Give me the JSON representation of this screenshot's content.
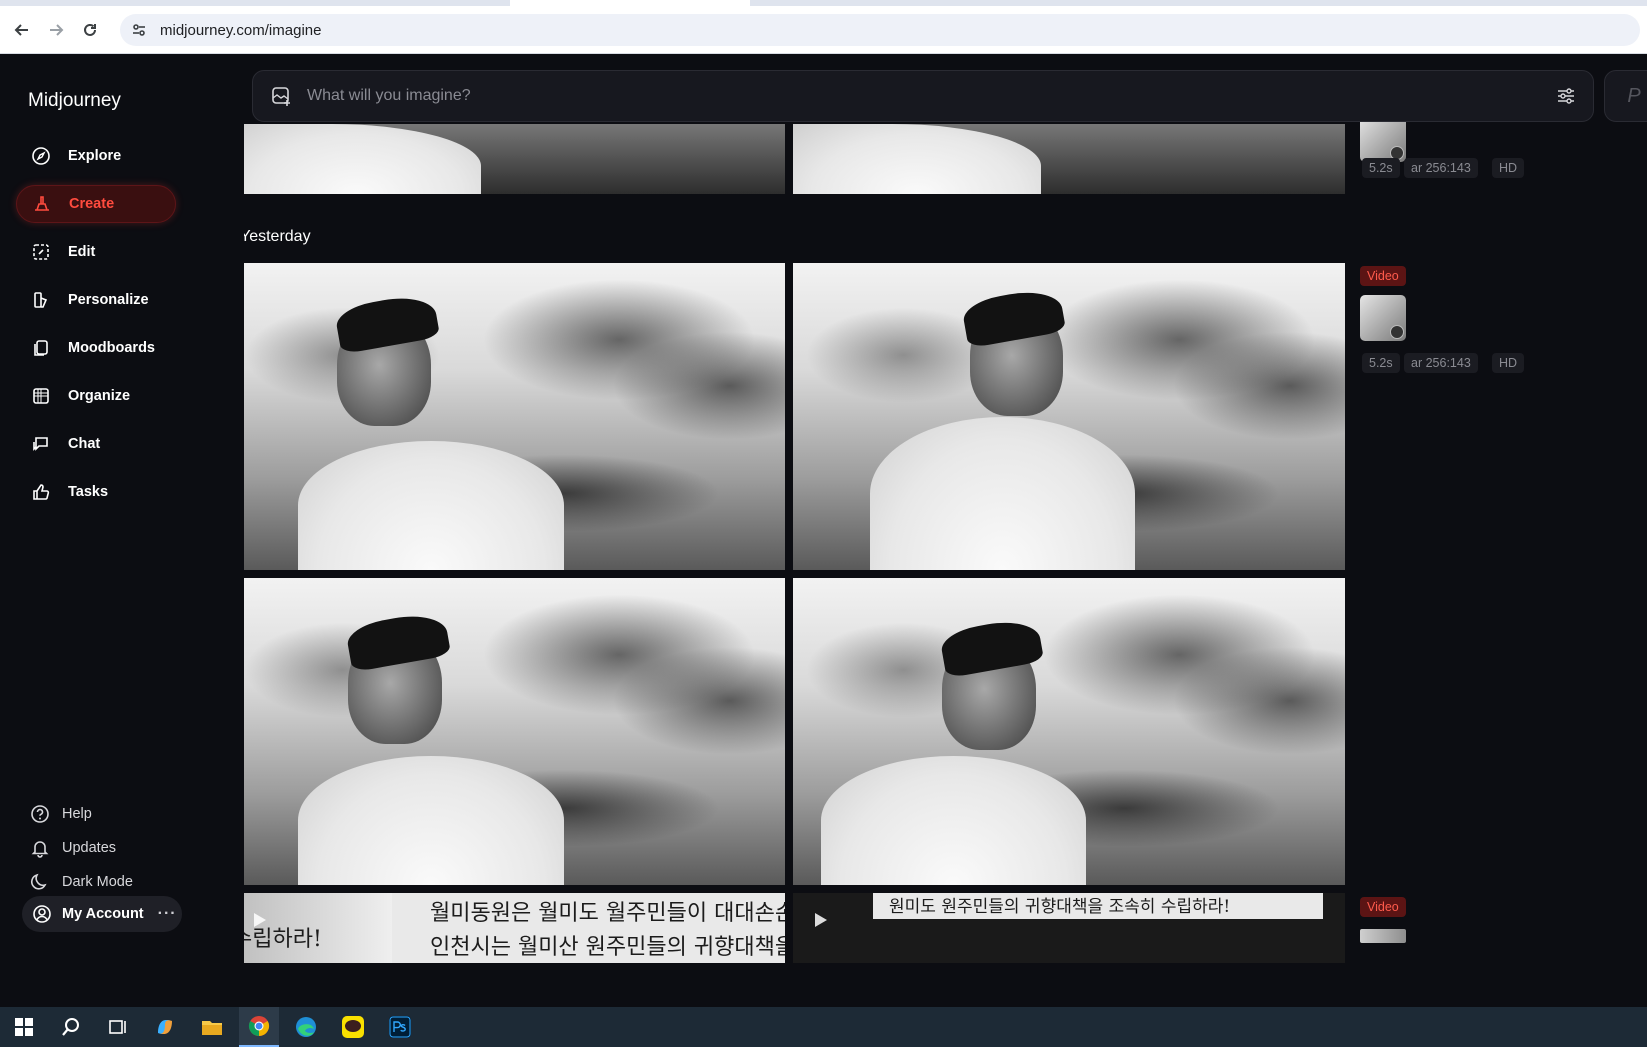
{
  "browser": {
    "url": "midjourney.com/imagine"
  },
  "sidebar": {
    "brand": "Midjourney",
    "items": [
      {
        "label": "Explore"
      },
      {
        "label": "Create"
      },
      {
        "label": "Edit"
      },
      {
        "label": "Personalize"
      },
      {
        "label": "Moodboards"
      },
      {
        "label": "Organize"
      },
      {
        "label": "Chat"
      },
      {
        "label": "Tasks"
      }
    ],
    "bottom": [
      {
        "label": "Help"
      },
      {
        "label": "Updates"
      },
      {
        "label": "Dark Mode"
      }
    ],
    "account": "My Account",
    "account_more": "···"
  },
  "prompt": {
    "placeholder": "What will you imagine?",
    "side_letter": "P"
  },
  "feed": {
    "section_yesterday": "Yesterday",
    "top_meta": {
      "duration": "5.2s",
      "ar": "ar 256:143",
      "quality": "HD"
    },
    "yesterday_meta": {
      "badge": "Video",
      "duration": "5.2s",
      "ar": "ar 256:143",
      "quality": "HD"
    },
    "next_meta": {
      "badge": "Video"
    },
    "banner_lines": {
      "left_top": "월미동원은 월미도 월주민들이 대대손손",
      "left_bottom": "인천시는 월미산 원주민들의 귀향대책을",
      "left_side_top": "수립하라!",
      "right_top": "원미도 원주민들의 귀향대책을 조속히 수립하라!"
    }
  },
  "colors": {
    "accent": "#ff4b3e",
    "background": "#0c0d12",
    "taskbar": "#1d2a36"
  }
}
